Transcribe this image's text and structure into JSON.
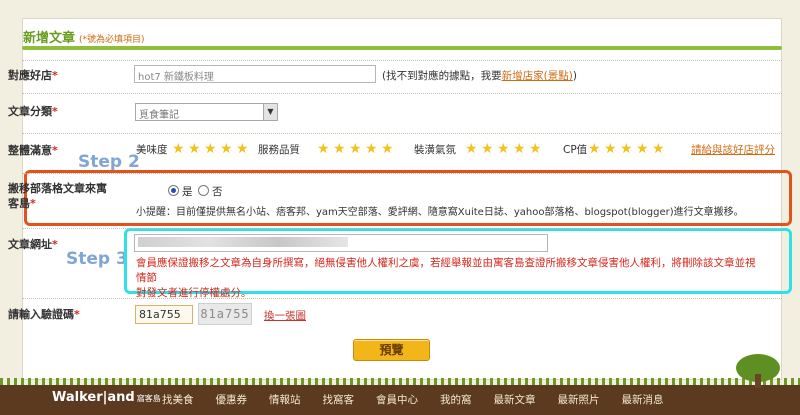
{
  "form": {
    "title": "新增文章",
    "title_note": "(*號為必填項目)",
    "required_mark": "*",
    "store": {
      "label": "對應好店",
      "placeholder": "hot7 新鐵板料理",
      "hint_text": "(找不到對應的據點，我要",
      "hint_link": "新增店家(景點)",
      "hint_close": ")"
    },
    "category": {
      "label": "文章分類",
      "selected": "覓食筆記"
    },
    "rating": {
      "label": "整體滿意",
      "groups": [
        "美味度",
        "服務品質",
        "裝潢氣氛",
        "CP值"
      ],
      "link": "請給與該好店評分"
    },
    "move": {
      "label_line1": "搬移部落格文章來寓",
      "label_line2": "客島",
      "yes": "是",
      "no": "否",
      "selected": "是",
      "tip": "小提醒：目前僅提供無名小站、痞客邦、yam天空部落、愛評網、隨意窩Xuite日誌、yahoo部落格、blogspot(blogger)進行文章搬移。"
    },
    "url": {
      "label": "文章網址",
      "warning_line1": "會員應保證搬移之文章為自身所撰寫，絕無侵害他人權利之虞，若經舉報並由寓客島查證所搬移文章侵害他人權利，將刪除該文章並視情節",
      "warning_line2": "對發文者進行停權處分。"
    },
    "captcha": {
      "label": "請輸入驗證碼",
      "value": "81a755",
      "image_text": "81a755",
      "refresh": "換一張圖"
    },
    "preview_button": "預覽"
  },
  "annotations": {
    "step2": "Step 2",
    "step3": "Step 3"
  },
  "footer": {
    "logo": "Walker|and",
    "logo_sub": "窩客島",
    "nav": [
      "找美食",
      "優惠券",
      "情報站",
      "找窩客",
      "會員中心",
      "我的窩",
      "最新文章",
      "最新照片",
      "最新消息"
    ]
  }
}
